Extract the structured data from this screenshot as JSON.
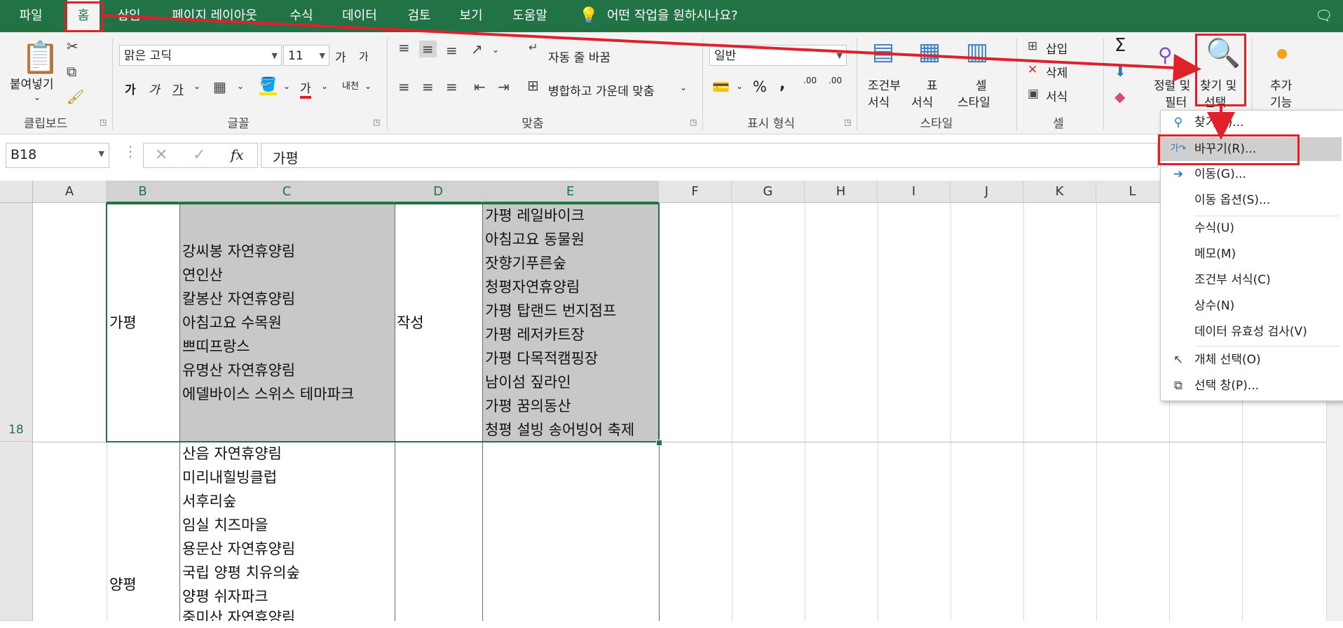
{
  "menu": {
    "tabs": [
      "파일",
      "홈",
      "삽입",
      "페이지 레이아웃",
      "수식",
      "데이터",
      "검토",
      "보기",
      "도움말"
    ],
    "active": "홈",
    "tell_me": "어떤 작업을 원하시나요?"
  },
  "ribbon": {
    "clipboard": {
      "paste": "붙여넣기",
      "label": "클립보드"
    },
    "font": {
      "name": "맑은 고딕",
      "size": "11",
      "bold": "가",
      "italic": "가",
      "underline": "가",
      "font_color": "가",
      "label": "글꼴",
      "grow": "가",
      "shrink": "가",
      "phonetic": "내천"
    },
    "alignment": {
      "wrap": "자동 줄 바꿈",
      "merge": "병합하고 가운데 맞춤",
      "label": "맞춤"
    },
    "number": {
      "format": "일반",
      "percent": "%",
      "comma": ",",
      "inc_decimal": ".00",
      "dec_decimal": ".00",
      "label": "표시 형식"
    },
    "styles": {
      "cond": "조건부\n서식",
      "cond1": "조건부",
      "cond2": "서식",
      "table1": "표",
      "table2": "서식",
      "cell1": "셀",
      "cell2": "스타일",
      "label": "스타일"
    },
    "cells": {
      "insert": "삽입",
      "delete": "삭제",
      "format": "서식",
      "label": "셀"
    },
    "editing": {
      "sort1": "정렬 및",
      "sort2": "필터",
      "find1": "찾기 및",
      "find2": "선택",
      "sigma": "Σ"
    },
    "addins": {
      "line1": "추가",
      "line2": "기능"
    }
  },
  "formula_bar": {
    "name_box": "B18",
    "fx": "fx",
    "value": "가평"
  },
  "columns": [
    "A",
    "B",
    "C",
    "D",
    "E",
    "F",
    "G",
    "H",
    "I",
    "J",
    "K",
    "L"
  ],
  "rows": {
    "r18": "18"
  },
  "cells": {
    "b18": "가평",
    "c18": [
      "강씨봉 자연휴양림",
      "연인산",
      "칼봉산 자연휴양림",
      "아침고요 수목원",
      "쁘띠프랑스",
      "유명산 자연휴양림",
      "에델바이스 스위스 테마파크"
    ],
    "d18": "작성",
    "e18": [
      "가평 레일바이크",
      "아침고요 동물원",
      "잣향기푸른숲",
      "청평자연휴양림",
      "가평 탑랜드 번지점프",
      "가평 레저카트장",
      "가평 다목적캠핑장",
      "남이섬 짚라인",
      "가평 꿈의동산",
      "청평 설빙 송어빙어 축제"
    ],
    "b19": "양평",
    "c19": [
      "산음 자연휴양림",
      "미리내힐빙클럽",
      "서후리숲",
      "임실 치즈마을",
      "용문산 자연휴양림",
      "국립 양평 치유의숲",
      "양평 쉬자파크",
      "중미산 자연휴양림"
    ]
  },
  "dropdown": {
    "items": [
      {
        "label": "찾기(F)...",
        "icon": "search-icon"
      },
      {
        "label": "바꾸기(R)...",
        "icon": "replace-icon"
      },
      {
        "label": "이동(G)...",
        "icon": "arrow-right-icon"
      },
      {
        "label": "이동 옵션(S)...",
        "icon": ""
      },
      {
        "label": "수식(U)",
        "icon": ""
      },
      {
        "label": "메모(M)",
        "icon": ""
      },
      {
        "label": "조건부 서식(C)",
        "icon": ""
      },
      {
        "label": "상수(N)",
        "icon": ""
      },
      {
        "label": "데이터 유효성 검사(V)",
        "icon": ""
      },
      {
        "label": "개체 선택(O)",
        "icon": "pointer-icon"
      },
      {
        "label": "선택 창(P)...",
        "icon": "selection-pane-icon"
      }
    ]
  },
  "colors": {
    "excel_green": "#217346",
    "annotation_red": "#e0212b",
    "selection_gray": "#c8c8c8"
  }
}
